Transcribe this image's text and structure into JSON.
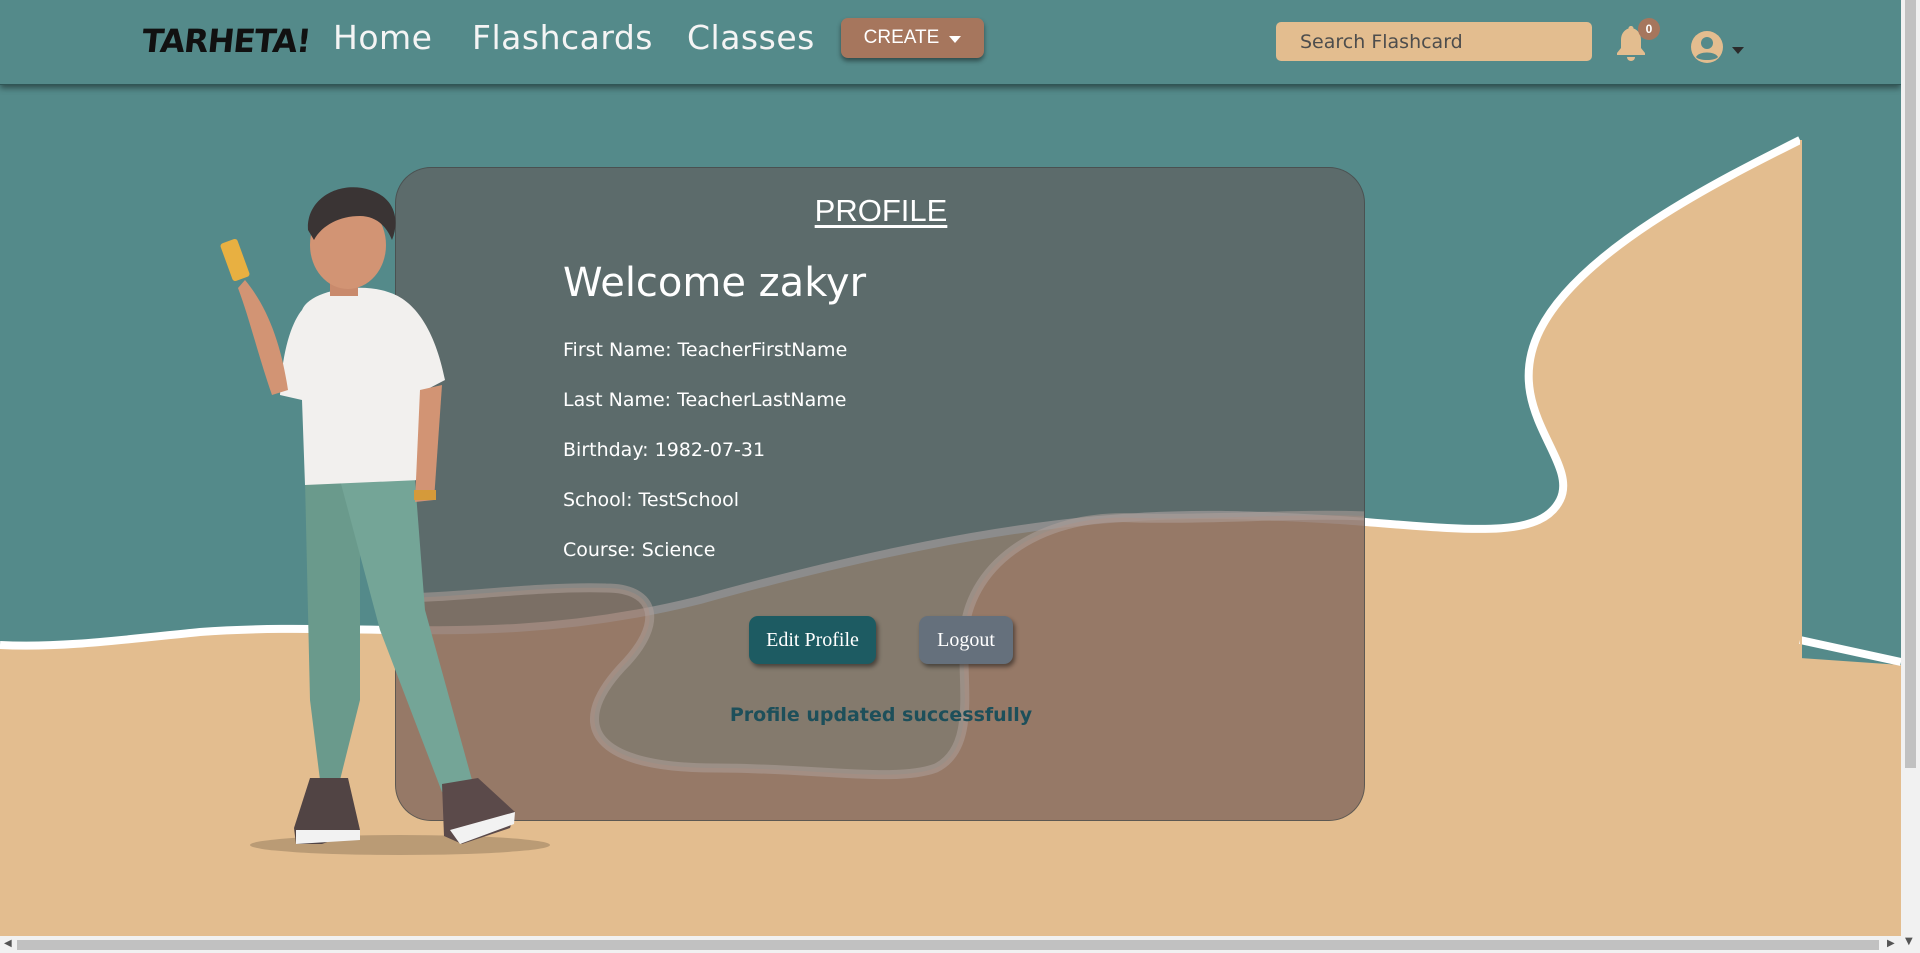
{
  "navbar": {
    "brand": "TARHETA!",
    "links": [
      "Home",
      "Flashcards",
      "Classes"
    ],
    "create_label": "CREATE",
    "search_placeholder": "Search Flashcard",
    "notification_count": "0",
    "notification_icon": "bell-icon",
    "user_icon": "user-circle-icon"
  },
  "profile": {
    "title": " PROFILE ",
    "welcome": "Welcome zakyr",
    "fields": [
      "First Name: TeacherFirstName",
      "Last Name: TeacherLastName",
      "Birthday: 1982-07-31",
      "School: TestSchool",
      "Course: Science"
    ],
    "edit_label": "Edit Profile",
    "logout_label": "Logout",
    "message": "Profile updated successfully"
  },
  "colors": {
    "navbar_bg": "#548a8a",
    "sand": "#e3bd8f",
    "accent_brown": "#a6765d",
    "edit_button": "#1d5b62",
    "logout_button": "#65707c",
    "success_text": "#1d4f5a"
  }
}
